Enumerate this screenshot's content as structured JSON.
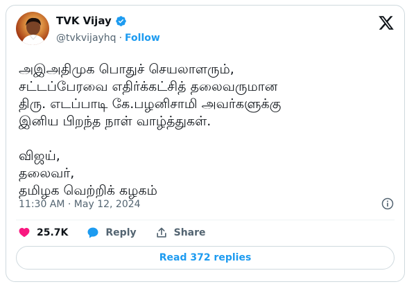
{
  "author": {
    "name": "TVK Vijay",
    "handle": "@tvkvijayhq",
    "separator": "·",
    "follow_label": "Follow"
  },
  "tweet": {
    "text": "அஇஅதிமுக பொதுச் செயலாளரும்,\nசட்டப்பேரவை எதிர்க்கட்சித் தலைவருமான\nதிரு. எடப்பாடி கே.பழனிசாமி அவர்களுக்கு\nஇனிய பிறந்த நாள் வாழ்த்துகள்.\n\nவிஜய்,\nதலைவர்,\nதமிழக வெற்றிக் கழகம்",
    "timestamp": "11:30 AM · May 12, 2024"
  },
  "actions": {
    "likes": "25.7K",
    "reply_label": "Reply",
    "share_label": "Share"
  },
  "replies_button": "Read 372 replies",
  "colors": {
    "accent": "#1d9bf0",
    "like": "#f91880",
    "muted": "#536471",
    "border": "#cfd9de"
  },
  "icons": [
    "verified-badge-icon",
    "x-logo-icon",
    "info-icon",
    "heart-icon",
    "reply-bubble-icon",
    "share-icon"
  ]
}
